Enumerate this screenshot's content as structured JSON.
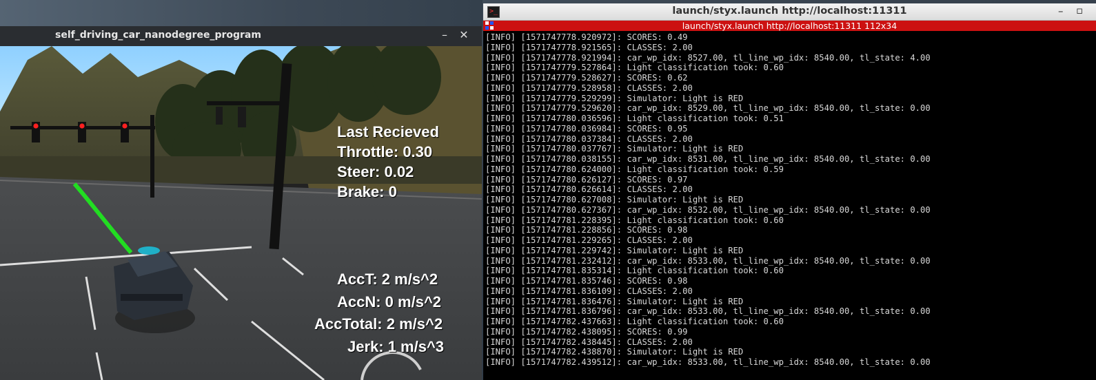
{
  "simulator": {
    "title": "self_driving_car_nanodegree_program",
    "minimize_glyph": "–",
    "close_glyph": "✕",
    "hud": {
      "last_received": "Last Recieved",
      "throttle": "Throttle: 0.30",
      "steer": "Steer: 0.02",
      "brake": "Brake: 0",
      "acc_t": "AccT: 2 m/s^2",
      "acc_n": "AccN: 0 m/s^2",
      "acc_total": "AccTotal: 2 m/s^2",
      "jerk": "Jerk: 1 m/s^3"
    }
  },
  "terminal": {
    "window_title": "launch/styx.launch http://localhost:11311",
    "tab_title": "launch/styx.launch http://localhost:11311 112x34",
    "minimize_glyph": "–",
    "maximize_glyph": "▫",
    "lines": [
      "[INFO] [1571747778.920972]: SCORES: 0.49",
      "[INFO] [1571747778.921565]: CLASSES: 2.00",
      "[INFO] [1571747778.921994]: car_wp_idx: 8527.00, tl_line_wp_idx: 8540.00, tl_state: 4.00",
      "[INFO] [1571747779.527864]: Light classification took: 0.60",
      "[INFO] [1571747779.528627]: SCORES: 0.62",
      "[INFO] [1571747779.528958]: CLASSES: 2.00",
      "[INFO] [1571747779.529299]: Simulator: Light is RED",
      "[INFO] [1571747779.529620]: car_wp_idx: 8529.00, tl_line_wp_idx: 8540.00, tl_state: 0.00",
      "[INFO] [1571747780.036596]: Light classification took: 0.51",
      "[INFO] [1571747780.036984]: SCORES: 0.95",
      "[INFO] [1571747780.037384]: CLASSES: 2.00",
      "[INFO] [1571747780.037767]: Simulator: Light is RED",
      "[INFO] [1571747780.038155]: car_wp_idx: 8531.00, tl_line_wp_idx: 8540.00, tl_state: 0.00",
      "[INFO] [1571747780.624000]: Light classification took: 0.59",
      "[INFO] [1571747780.626127]: SCORES: 0.97",
      "[INFO] [1571747780.626614]: CLASSES: 2.00",
      "[INFO] [1571747780.627008]: Simulator: Light is RED",
      "[INFO] [1571747780.627367]: car_wp_idx: 8532.00, tl_line_wp_idx: 8540.00, tl_state: 0.00",
      "[INFO] [1571747781.228395]: Light classification took: 0.60",
      "[INFO] [1571747781.228856]: SCORES: 0.98",
      "[INFO] [1571747781.229265]: CLASSES: 2.00",
      "[INFO] [1571747781.229742]: Simulator: Light is RED",
      "[INFO] [1571747781.232412]: car_wp_idx: 8533.00, tl_line_wp_idx: 8540.00, tl_state: 0.00",
      "[INFO] [1571747781.835314]: Light classification took: 0.60",
      "[INFO] [1571747781.835746]: SCORES: 0.98",
      "[INFO] [1571747781.836109]: CLASSES: 2.00",
      "[INFO] [1571747781.836476]: Simulator: Light is RED",
      "[INFO] [1571747781.836796]: car_wp_idx: 8533.00, tl_line_wp_idx: 8540.00, tl_state: 0.00",
      "[INFO] [1571747782.437663]: Light classification took: 0.60",
      "[INFO] [1571747782.438095]: SCORES: 0.99",
      "[INFO] [1571747782.438445]: CLASSES: 2.00",
      "[INFO] [1571747782.438870]: Simulator: Light is RED",
      "[INFO] [1571747782.439512]: car_wp_idx: 8533.00, tl_line_wp_idx: 8540.00, tl_state: 0.00"
    ]
  },
  "colors": {
    "terminal_tab_bar": "#cc1111",
    "traffic_light_red": "#ff2020",
    "waypoint_path": "#22dd22"
  }
}
